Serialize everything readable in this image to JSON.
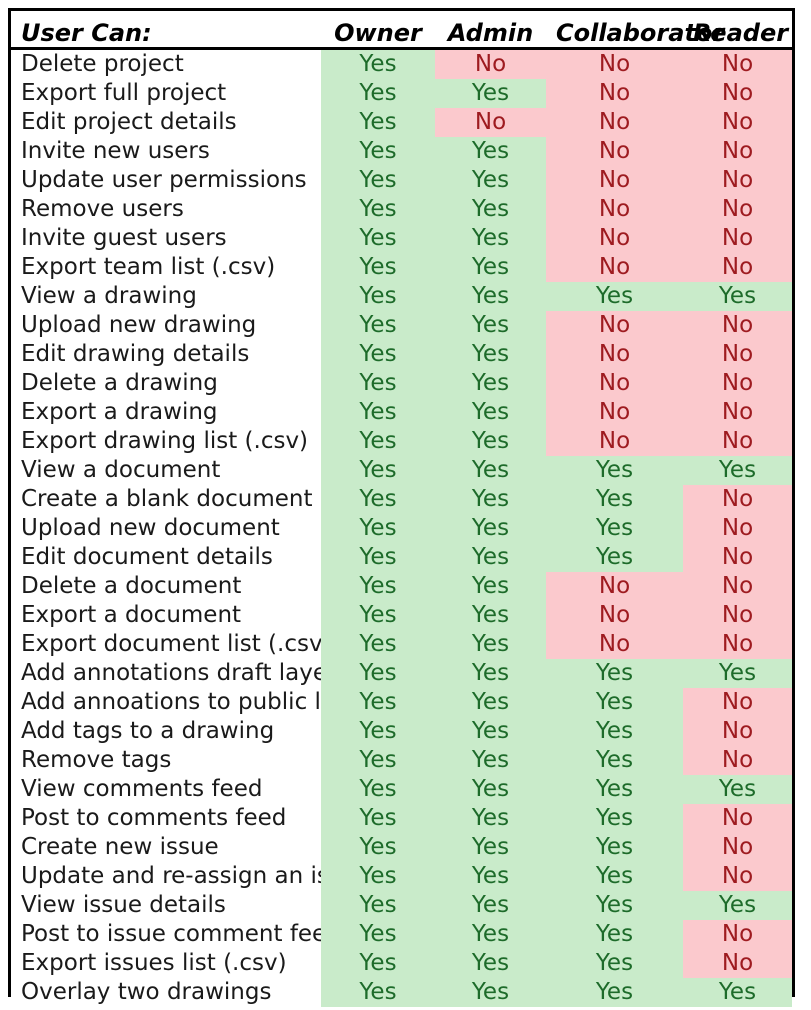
{
  "table": {
    "columns": [
      {
        "key": "action",
        "label": "User Can:"
      },
      {
        "key": "owner",
        "label": "Owner"
      },
      {
        "key": "admin",
        "label": "Admin"
      },
      {
        "key": "collaborator",
        "label": "Collaborator"
      },
      {
        "key": "reader",
        "label": "Reader"
      }
    ],
    "yes_label": "Yes",
    "no_label": "No",
    "colors": {
      "yes_bg": "#c9ebca",
      "yes_text": "#1d6b2a",
      "no_bg": "#fbc9cd",
      "no_text": "#9e1b20",
      "border": "#000000",
      "page_bg": "#ffffff",
      "text": "#1a1a1a"
    },
    "rows": [
      {
        "action": "Delete project",
        "owner": "Yes",
        "admin": "No",
        "collaborator": "No",
        "reader": "No"
      },
      {
        "action": "Export full project",
        "owner": "Yes",
        "admin": "Yes",
        "collaborator": "No",
        "reader": "No"
      },
      {
        "action": "Edit project details",
        "owner": "Yes",
        "admin": "No",
        "collaborator": "No",
        "reader": "No"
      },
      {
        "action": "Invite new users",
        "owner": "Yes",
        "admin": "Yes",
        "collaborator": "No",
        "reader": "No"
      },
      {
        "action": "Update user permissions",
        "owner": "Yes",
        "admin": "Yes",
        "collaborator": "No",
        "reader": "No"
      },
      {
        "action": "Remove users",
        "owner": "Yes",
        "admin": "Yes",
        "collaborator": "No",
        "reader": "No"
      },
      {
        "action": "Invite guest users",
        "owner": "Yes",
        "admin": "Yes",
        "collaborator": "No",
        "reader": "No"
      },
      {
        "action": "Export team list (.csv)",
        "owner": "Yes",
        "admin": "Yes",
        "collaborator": "No",
        "reader": "No"
      },
      {
        "action": "View a drawing",
        "owner": "Yes",
        "admin": "Yes",
        "collaborator": "Yes",
        "reader": "Yes"
      },
      {
        "action": "Upload new drawing",
        "owner": "Yes",
        "admin": "Yes",
        "collaborator": "No",
        "reader": "No"
      },
      {
        "action": "Edit drawing details",
        "owner": "Yes",
        "admin": "Yes",
        "collaborator": "No",
        "reader": "No"
      },
      {
        "action": "Delete a drawing",
        "owner": "Yes",
        "admin": "Yes",
        "collaborator": "No",
        "reader": "No"
      },
      {
        "action": "Export a drawing",
        "owner": "Yes",
        "admin": "Yes",
        "collaborator": "No",
        "reader": "No"
      },
      {
        "action": "Export drawing list (.csv)",
        "owner": "Yes",
        "admin": "Yes",
        "collaborator": "No",
        "reader": "No"
      },
      {
        "action": "View a document",
        "owner": "Yes",
        "admin": "Yes",
        "collaborator": "Yes",
        "reader": "Yes"
      },
      {
        "action": "Create a blank document",
        "owner": "Yes",
        "admin": "Yes",
        "collaborator": "Yes",
        "reader": "No"
      },
      {
        "action": "Upload new document",
        "owner": "Yes",
        "admin": "Yes",
        "collaborator": "Yes",
        "reader": "No"
      },
      {
        "action": "Edit document details",
        "owner": "Yes",
        "admin": "Yes",
        "collaborator": "Yes",
        "reader": "No"
      },
      {
        "action": "Delete a document",
        "owner": "Yes",
        "admin": "Yes",
        "collaborator": "No",
        "reader": "No"
      },
      {
        "action": "Export a document",
        "owner": "Yes",
        "admin": "Yes",
        "collaborator": "No",
        "reader": "No"
      },
      {
        "action": "Export document list (.csv)",
        "owner": "Yes",
        "admin": "Yes",
        "collaborator": "No",
        "reader": "No"
      },
      {
        "action": "Add annotations draft layer",
        "owner": "Yes",
        "admin": "Yes",
        "collaborator": "Yes",
        "reader": "Yes"
      },
      {
        "action": "Add annoations to public layer",
        "owner": "Yes",
        "admin": "Yes",
        "collaborator": "Yes",
        "reader": "No"
      },
      {
        "action": "Add tags to a drawing",
        "owner": "Yes",
        "admin": "Yes",
        "collaborator": "Yes",
        "reader": "No"
      },
      {
        "action": "Remove tags",
        "owner": "Yes",
        "admin": "Yes",
        "collaborator": "Yes",
        "reader": "No"
      },
      {
        "action": "View comments feed",
        "owner": "Yes",
        "admin": "Yes",
        "collaborator": "Yes",
        "reader": "Yes"
      },
      {
        "action": "Post to comments feed",
        "owner": "Yes",
        "admin": "Yes",
        "collaborator": "Yes",
        "reader": "No"
      },
      {
        "action": "Create new issue",
        "owner": "Yes",
        "admin": "Yes",
        "collaborator": "Yes",
        "reader": "No"
      },
      {
        "action": "Update and re-assign an issue",
        "owner": "Yes",
        "admin": "Yes",
        "collaborator": "Yes",
        "reader": "No"
      },
      {
        "action": "View issue details",
        "owner": "Yes",
        "admin": "Yes",
        "collaborator": "Yes",
        "reader": "Yes"
      },
      {
        "action": "Post to issue comment feed.",
        "owner": "Yes",
        "admin": "Yes",
        "collaborator": "Yes",
        "reader": "No"
      },
      {
        "action": "Export issues list (.csv)",
        "owner": "Yes",
        "admin": "Yes",
        "collaborator": "Yes",
        "reader": "No"
      },
      {
        "action": "Overlay two drawings",
        "owner": "Yes",
        "admin": "Yes",
        "collaborator": "Yes",
        "reader": "Yes"
      }
    ]
  }
}
